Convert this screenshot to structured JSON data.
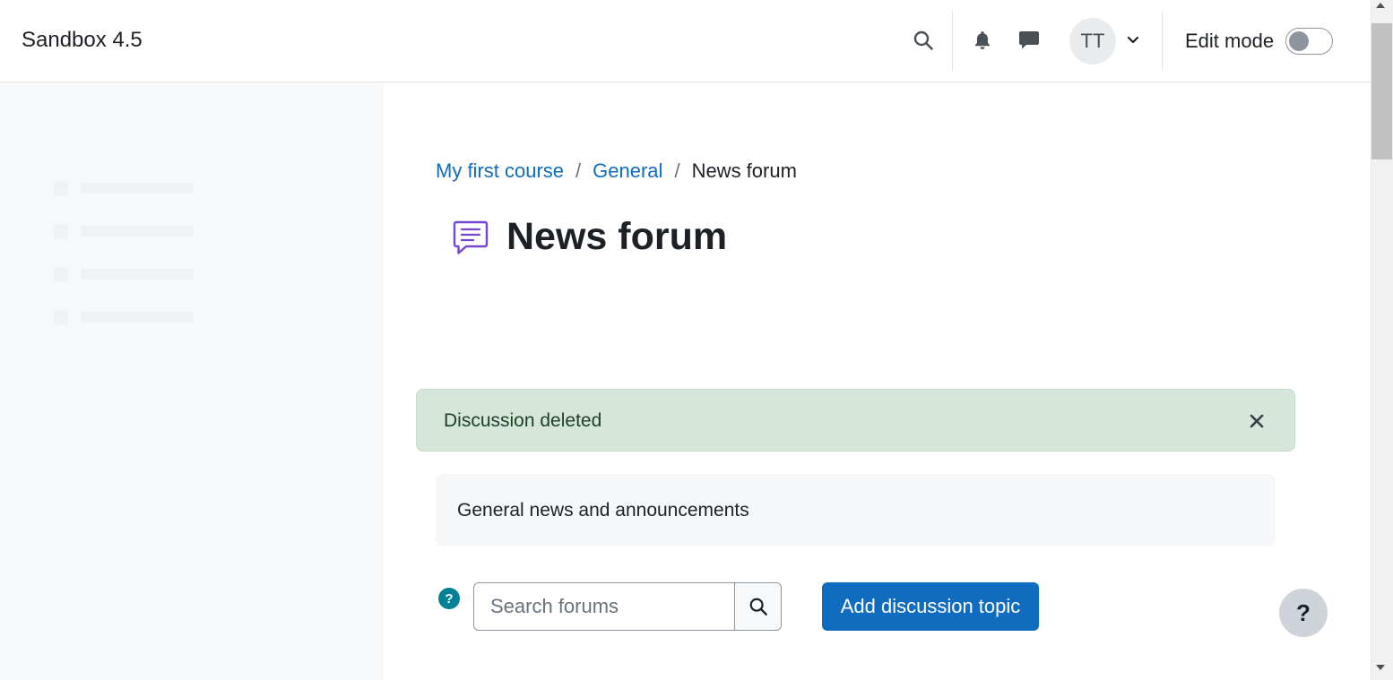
{
  "header": {
    "site_name": "Sandbox 4.5",
    "user_initials": "TT",
    "edit_mode_label": "Edit mode",
    "edit_mode_on": false
  },
  "breadcrumb": {
    "items": [
      "My first course",
      "General"
    ],
    "separator": "/",
    "current": "News forum"
  },
  "page": {
    "title": "News forum"
  },
  "alert": {
    "message": "Discussion deleted",
    "close_glyph": "×"
  },
  "intro": {
    "text": "General news and announcements"
  },
  "search": {
    "placeholder": "Search forums",
    "value": ""
  },
  "actions": {
    "add_discussion": "Add discussion topic",
    "help_badge": "?",
    "help_fab": "?"
  },
  "colors": {
    "primary": "#0f6cbf",
    "success_bg": "#d7e6da",
    "help_badge": "#008196",
    "forum_icon": "#7645cd"
  },
  "icons": [
    "search-icon",
    "bell-icon",
    "chat-icon",
    "chevron-down-icon",
    "forum-icon",
    "close-icon",
    "help-icon"
  ]
}
